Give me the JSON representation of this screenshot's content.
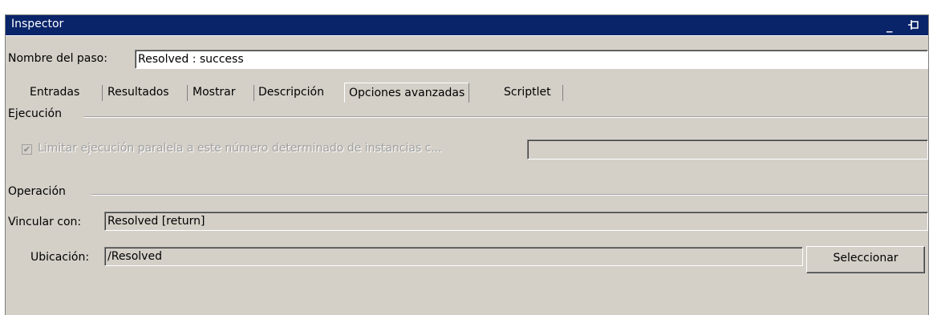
{
  "window": {
    "title": "Inspector",
    "minimize_glyph": "_",
    "pin_glyph": "⊣"
  },
  "step": {
    "name_label": "Nombre del paso:",
    "name_value": "Resolved : success"
  },
  "tabs": [
    {
      "label": "Entradas",
      "active": false
    },
    {
      "label": "Resultados",
      "active": false
    },
    {
      "label": "Mostrar",
      "active": false
    },
    {
      "label": "Descripción",
      "active": false
    },
    {
      "label": "Opciones avanzadas",
      "active": true
    },
    {
      "label": "Scriptlet",
      "active": false
    }
  ],
  "execution": {
    "group_label": "Ejecución",
    "limit_checkbox_label": "Limitar ejecución paralela a este número determinado de instancias c...",
    "limit_checked": true,
    "limit_value": ""
  },
  "operation": {
    "group_label": "Operación",
    "link_label": "Vincular con:",
    "link_value": "Resolved [return]",
    "location_label": "Ubicación:",
    "location_value": "/Resolved",
    "select_button": "Seleccionar"
  },
  "icons": {
    "minimize": "minimize-icon",
    "pin": "pin-icon",
    "checkbox": "checkmark-icon"
  }
}
